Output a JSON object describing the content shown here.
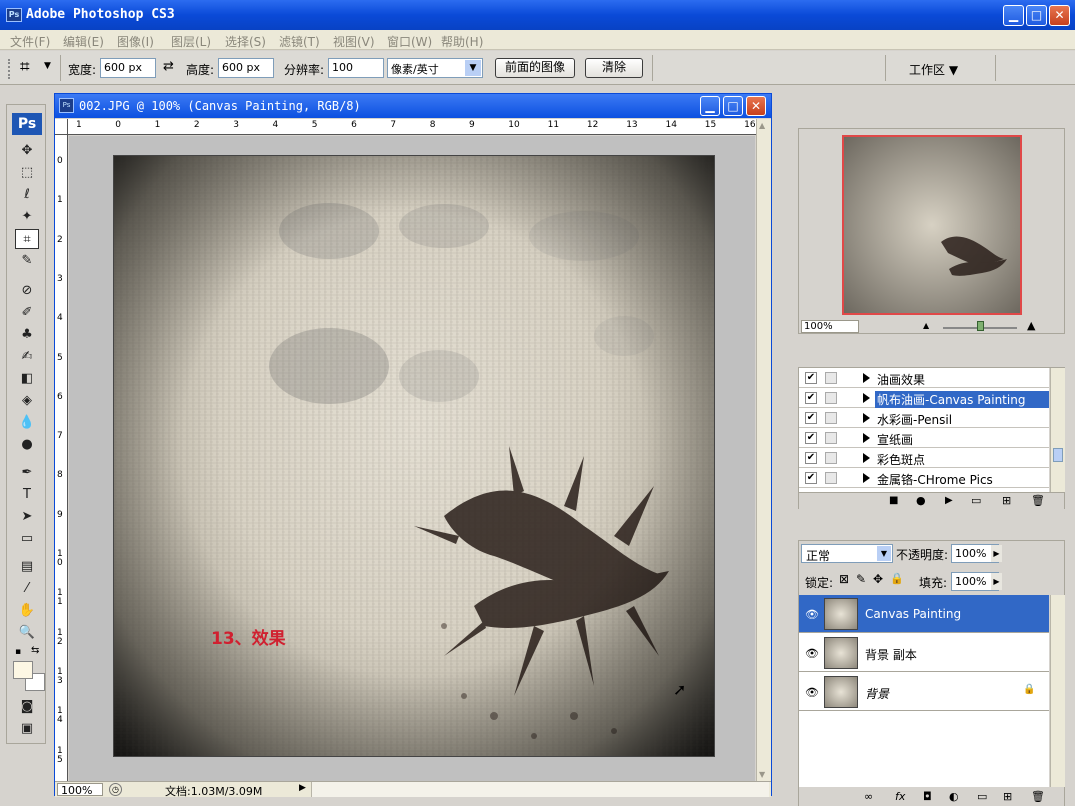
{
  "app": {
    "title": "Adobe Photoshop CS3",
    "icon": "ps-icon"
  },
  "menu": [
    "文件(F)",
    "编辑(E)",
    "图像(I)",
    "图层(L)",
    "选择(S)",
    "滤镜(T)",
    "视图(V)",
    "窗口(W)",
    "帮助(H)"
  ],
  "options": {
    "width_label": "宽度:",
    "width_value": "600 px",
    "height_label": "高度:",
    "height_value": "600 px",
    "resolution_label": "分辨率:",
    "resolution_value": "100",
    "unit_value": "像素/英寸",
    "front_image_button": "前面的图像",
    "clear_button": "清除",
    "workspace_button": "工作区 ▼"
  },
  "document": {
    "title": "002.JPG @ 100% (Canvas Painting, RGB/8)",
    "ruler_top": [
      "1",
      "0",
      "1",
      "2",
      "3",
      "4",
      "5",
      "6",
      "7",
      "8",
      "9",
      "10",
      "11",
      "12",
      "13",
      "14",
      "15",
      "16"
    ],
    "ruler_left": [
      "0",
      "1",
      "2",
      "3",
      "4",
      "5",
      "6",
      "7",
      "8",
      "9",
      "1 0",
      "1 1",
      "1 2",
      "1 3",
      "1 4",
      "1 5"
    ],
    "annotation": "13、效果",
    "zoom": "100%",
    "status": "文档:1.03M/3.09M"
  },
  "navigator": {
    "zoom": "100%"
  },
  "actions": [
    {
      "label": "油画效果",
      "checked": true,
      "selected": false
    },
    {
      "label": "帆布油画-Canvas Painting",
      "checked": true,
      "selected": true
    },
    {
      "label": "水彩画-Pensil",
      "checked": true,
      "selected": false
    },
    {
      "label": "宣纸画",
      "checked": true,
      "selected": false
    },
    {
      "label": "彩色斑点",
      "checked": true,
      "selected": false
    },
    {
      "label": "金属铬-CHrome Pics",
      "checked": true,
      "selected": false
    }
  ],
  "layers": {
    "blend_mode": "正常",
    "opacity_label": "不透明度:",
    "opacity_value": "100%",
    "lock_label": "锁定:",
    "fill_label": "填充:",
    "fill_value": "100%",
    "items": [
      {
        "name": "Canvas Painting",
        "selected": true,
        "locked": false
      },
      {
        "name": "背景 副本",
        "selected": false,
        "locked": false
      },
      {
        "name": "背景",
        "selected": false,
        "locked": true
      }
    ]
  },
  "colors": {
    "accent": "#3168c6",
    "annotation": "#d02030",
    "titlebar": "#0a4ad8"
  }
}
